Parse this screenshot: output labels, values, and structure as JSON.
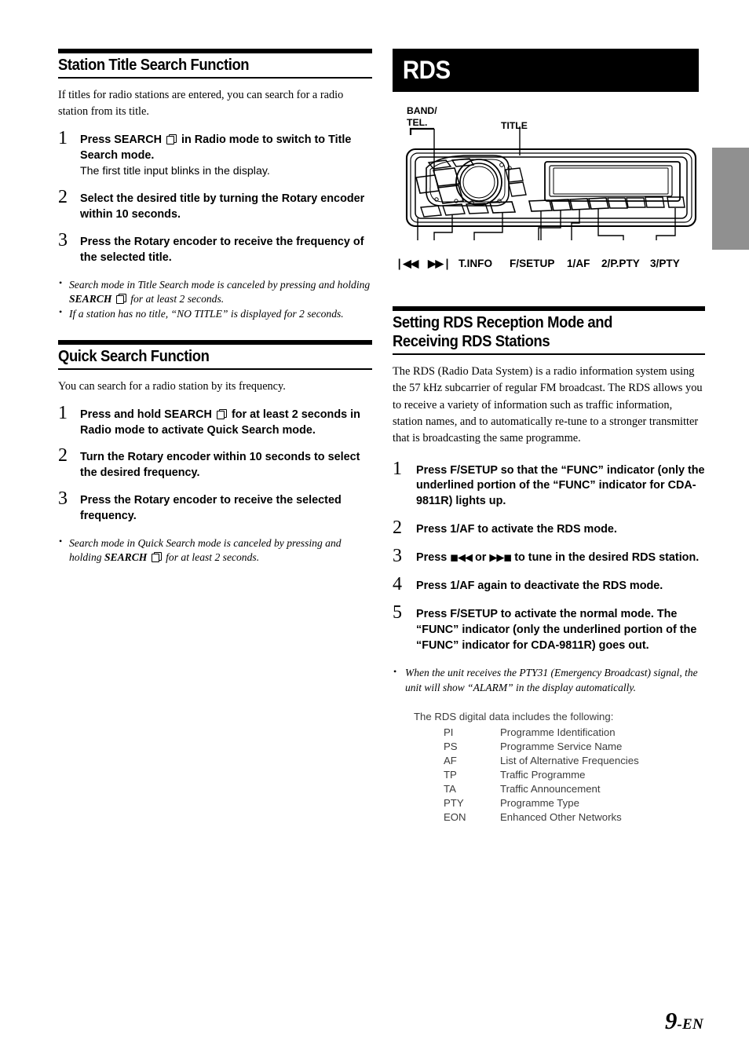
{
  "page": {
    "number": "9",
    "lang_suffix": "-EN"
  },
  "left_column": {
    "section1": {
      "heading": "Station Title Search Function",
      "intro": "If titles for radio stations are entered, you can search for a radio station from its title.",
      "steps": [
        {
          "num": "1",
          "text_parts": [
            "Press ",
            "SEARCH",
            " □ in Radio mode to switch to Title Search mode."
          ],
          "text": "Press SEARCH in Radio mode to switch to Title Search mode.",
          "sub": "The first title input blinks in the display."
        },
        {
          "num": "2",
          "text": "Select the desired title by turning the Rotary encoder within 10 seconds.",
          "sub": ""
        },
        {
          "num": "3",
          "text": "Press the Rotary encoder to receive the frequency of the selected title.",
          "sub": ""
        }
      ],
      "notes": [
        "Search mode in Title Search mode is canceled by pressing and holding SEARCH for at least 2 seconds.",
        "If a station has no title, “NO TITLE” is displayed for 2 seconds."
      ]
    },
    "section2": {
      "heading": "Quick Search Function",
      "intro": "You can search for a radio station by its frequency.",
      "steps": [
        {
          "num": "1",
          "text": "Press and hold SEARCH for at least 2 seconds in Radio mode to activate Quick Search mode.",
          "sub": ""
        },
        {
          "num": "2",
          "text": "Turn the Rotary encoder within 10 seconds to select the desired frequency.",
          "sub": ""
        },
        {
          "num": "3",
          "text": "Press the Rotary encoder to receive the selected frequency.",
          "sub": ""
        }
      ],
      "notes": [
        "Search mode in Quick Search mode is canceled by pressing and holding SEARCH for at least 2 seconds."
      ]
    }
  },
  "right_column": {
    "banner_title": "RDS",
    "figure": {
      "callouts": [
        {
          "label": "BAND/\nTEL.",
          "name": "band-tel"
        },
        {
          "label": "TITLE",
          "name": "title"
        }
      ],
      "button_labels": [
        {
          "label": "❘◀◀",
          "name": "prev-track"
        },
        {
          "label": "▶▶❘",
          "name": "next-track"
        },
        {
          "label": "T.INFO",
          "name": "t-info"
        },
        {
          "label": "F/SETUP",
          "name": "f-setup"
        },
        {
          "label": "1/AF",
          "name": "1-af"
        },
        {
          "label": "2/P.PTY",
          "name": "2-p-pty"
        },
        {
          "label": "3/PTY",
          "name": "3-pty"
        }
      ]
    },
    "section": {
      "heading": "Setting RDS Reception Mode and Receiving RDS Stations",
      "intro": "The RDS (Radio Data System) is a radio information system using the 57 kHz subcarrier of regular FM broadcast. The RDS allows you to receive a variety of information such as traffic information, station names, and to automatically re-tune to a stronger transmitter that is broadcasting the same programme.",
      "steps": [
        {
          "num": "1",
          "text": "Press F/SETUP so that the “FUNC” indicator (only the underlined portion of the “FUNC” indicator for CDA-9811R) lights up."
        },
        {
          "num": "2",
          "text": "Press 1/AF to activate the RDS mode."
        },
        {
          "num": "3",
          "text": "Press ❘◀◀ or ▶▶❘ to tune in the desired RDS station."
        },
        {
          "num": "4",
          "text": "Press 1/AF again to deactivate the RDS mode."
        },
        {
          "num": "5",
          "text": "Press F/SETUP to activate the normal mode. The “FUNC” indicator (only the underlined portion of the “FUNC” indicator for CDA-9811R) goes out."
        }
      ],
      "notes": [
        "When the unit receives the PTY31 (Emergency Broadcast) signal, the unit will show “ALARM” in the display automatically."
      ]
    },
    "rds_data": {
      "intro": "The RDS digital data includes the following:",
      "rows": [
        {
          "abbr": "PI",
          "desc": "Programme Identification"
        },
        {
          "abbr": "PS",
          "desc": "Programme Service Name"
        },
        {
          "abbr": "AF",
          "desc": "List of Alternative Frequencies"
        },
        {
          "abbr": "TP",
          "desc": "Traffic Programme"
        },
        {
          "abbr": "TA",
          "desc": "Traffic Announcement"
        },
        {
          "abbr": "PTY",
          "desc": "Programme Type"
        },
        {
          "abbr": "EON",
          "desc": "Enhanced Other Networks"
        }
      ]
    }
  }
}
